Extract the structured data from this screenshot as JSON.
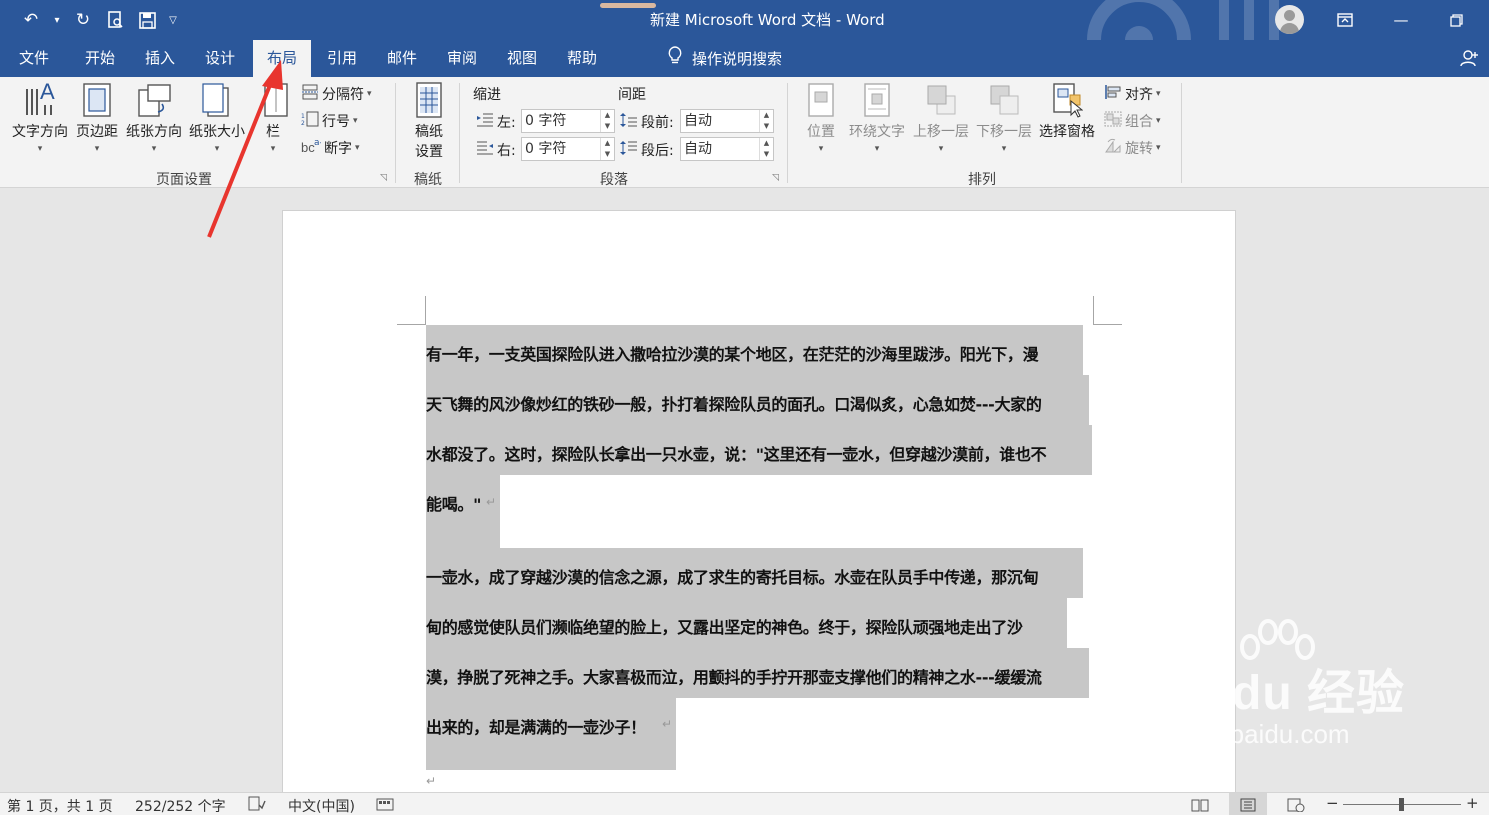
{
  "window": {
    "title": "新建 Microsoft Word 文档  -  Word",
    "accent_color": "#2b579a"
  },
  "qat": {
    "undo_icon": "undo-icon",
    "redo_icon": "redo-icon",
    "print_preview_icon": "print-preview-icon",
    "save_icon": "save-icon",
    "customize_icon": "chevron-down-icon"
  },
  "tabs": [
    {
      "label": "文件"
    },
    {
      "label": "开始"
    },
    {
      "label": "插入"
    },
    {
      "label": "设计"
    },
    {
      "label": "布局",
      "active": true
    },
    {
      "label": "引用"
    },
    {
      "label": "邮件"
    },
    {
      "label": "审阅"
    },
    {
      "label": "视图"
    },
    {
      "label": "帮助"
    }
  ],
  "tellme": {
    "label": "操作说明搜索"
  },
  "ribbon": {
    "page_setup": {
      "label": "页面设置",
      "text_direction": "文字方向",
      "margins": "页边距",
      "orientation": "纸张方向",
      "size": "纸张大小",
      "columns": "栏",
      "breaks": "分隔符",
      "line_numbers": "行号",
      "hyphenation": "断字"
    },
    "draft": {
      "label": "稿纸",
      "button": "稿纸\n设置",
      "button_line1": "稿纸",
      "button_line2": "设置"
    },
    "paragraph": {
      "label": "段落",
      "indent_title": "缩进",
      "spacing_title": "间距",
      "left_label": "左:",
      "left_value": "0 字符",
      "right_label": "右:",
      "right_value": "0 字符",
      "before_label": "段前:",
      "before_value": "自动",
      "after_label": "段后:",
      "after_value": "自动"
    },
    "arrange": {
      "label": "排列",
      "position": "位置",
      "wrap_text": "环绕文字",
      "bring_forward": "上移一层",
      "send_backward": "下移一层",
      "selection_pane": "选择窗格",
      "align": "对齐",
      "group": "组合",
      "rotate": "旋转"
    }
  },
  "document": {
    "lines": [
      "有一年，一支英国探险队进入撒哈拉沙漠的某个地区，在茫茫的沙海里跋涉。阳光下，漫",
      "天飞舞的风沙像炒红的铁砂一般，扑打着探险队员的面孔。口渴似炙，心急如焚---大家的",
      "水都没了。这时，探险队长拿出一只水壶，说：\"这里还有一壶水，但穿越沙漠前，谁也不",
      "能喝。\"",
      "一壶水，成了穿越沙漠的信念之源，成了求生的寄托目标。水壶在队员手中传递，那沉甸",
      "甸的感觉使队员们濒临绝望的脸上，又露出坚定的神色。终于，探险队顽强地走出了沙",
      "漠，挣脱了死神之手。大家喜极而泣，用颤抖的手拧开那壶支撑他们的精神之水---缓缓流",
      "出来的，却是满满的一壶沙子！"
    ],
    "paragraph_mark": "↵"
  },
  "watermark": {
    "brand": "Bai  du 经验",
    "url": "jingyan.baidu.com"
  },
  "status": {
    "page": "第 1 页，共 1 页",
    "words": "252/252 个字",
    "language": "中文(中国)"
  }
}
